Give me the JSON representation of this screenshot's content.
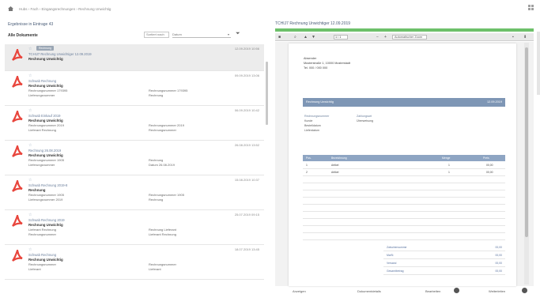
{
  "breadcrumb": [
    "Hubs",
    "Fach",
    "Eingangsrechnungen",
    "Rechnung Unwichtig"
  ],
  "left_panel": {
    "title": "Ergebnisse in Eintrage 43",
    "subhead": "Alle Dokumente",
    "sort_label": "Sortiert nach",
    "sort_value": "Datum",
    "rows": [
      {
        "tag": "Rechnung",
        "l1": "TCHIJ7 Rechnung Unwichtiger 12.09.2019",
        "l2": "Rechnung Unwichtig",
        "l3": "",
        "l4": "",
        "r1": "",
        "r2": "",
        "date": "12.09.2019 10:56"
      },
      {
        "tag": "",
        "l1": "Schwab Rechnung",
        "l2": "Rechnung Unwichtig",
        "l3": "Rechnungsnummer 179395",
        "l4": "Lieferungsnummer",
        "r1": "Rechnungsnummer 179395",
        "r2": "Rechnung",
        "date": "09.09.2019 13:06"
      },
      {
        "tag": "",
        "l1": "Schwab Einkauf 2019",
        "l2": "Rechnung Unwichtig",
        "l3": "Rechnungsnummer 2019",
        "l4": "Lieferant Rechnung",
        "r1": "Rechnungsnummer 2019",
        "r2": "Rechnungsnummer",
        "date": "06.09.2019 10:42"
      },
      {
        "tag": "",
        "l1": "Rechnung 26.08.2019",
        "l2": "Rechnung Unwichtig",
        "l3": "Rechnungsnummer 1905",
        "l4": "Lieferungsnummer",
        "r1": "Rechnung",
        "r2": "Datum 26.08.2019",
        "date": "26.08.2019 13:52"
      },
      {
        "tag": "",
        "l1": "Schwab Rechnung 2019-8",
        "l2": "Rechnung",
        "l3": "Rechnungsnummer 1905",
        "l4": "Lieferungsnummer 2019",
        "r1": "Rechnungsnummer 1905",
        "r2": "Rechnung",
        "date": "15.08.2019 10:37"
      },
      {
        "tag": "",
        "l1": "Schwab Rechnung 2019",
        "l2": "Rechnung Unwichtig",
        "l3": "Lieferant Rechnung",
        "l4": "Rechnungsnummer",
        "r1": "Rechnung Lieferant",
        "r2": "Lieferant Rechnung",
        "date": "25.07.2019 09:15"
      },
      {
        "tag": "",
        "l1": "Schwab Rechnung",
        "l2": "Rechnung Unwichtig",
        "l3": "Rechnungsnummer",
        "l4": "Lieferant",
        "r1": "Rechnungsnummer",
        "r2": "Lieferant",
        "date": "18.07.2019 13:45"
      }
    ]
  },
  "right_panel": {
    "title": "TCHIJ7 Rechnung Unwichtiger 12.09.2019",
    "page": "1 / 1",
    "zoom": "Automatischer Zoom",
    "address": [
      "Absender",
      "Musterstraße 1, 10000 Musterstadt",
      "Tel. 000 / 000 000"
    ],
    "band_left": "Rechnung Unwichtig",
    "band_right": "12.09.2019",
    "meta_left": [
      "Rechnungsnummer",
      "Kunde",
      "Bestelldatum",
      "Lieferdatum"
    ],
    "meta_right": [
      "Zahlungsart",
      "Überweisung"
    ],
    "table_headers": [
      "Pos.",
      "Bezeichnung",
      "Menge",
      "Preis"
    ],
    "table_rows": [
      {
        "pos": "1",
        "desc": "Artikel",
        "qty": "1",
        "price": "00,00"
      },
      {
        "pos": "2",
        "desc": "Artikel",
        "qty": "1",
        "price": "00,00"
      }
    ],
    "totals": [
      {
        "label": "Zwischensumme",
        "value": "00,00"
      },
      {
        "label": "MwSt",
        "value": "00,00"
      },
      {
        "label": "Versand",
        "value": "00,00"
      },
      {
        "label": "Gesamtbetrag",
        "value": "00,00"
      }
    ],
    "footer": [
      "Anzeigen",
      "Dokumentdetails",
      "Bearbeiten",
      "Weiterleiten"
    ]
  },
  "colors": {
    "accent": "#4a5d78",
    "progress": "#6dc06a",
    "pdf": "#e8453c",
    "band": "#7e96b5"
  }
}
